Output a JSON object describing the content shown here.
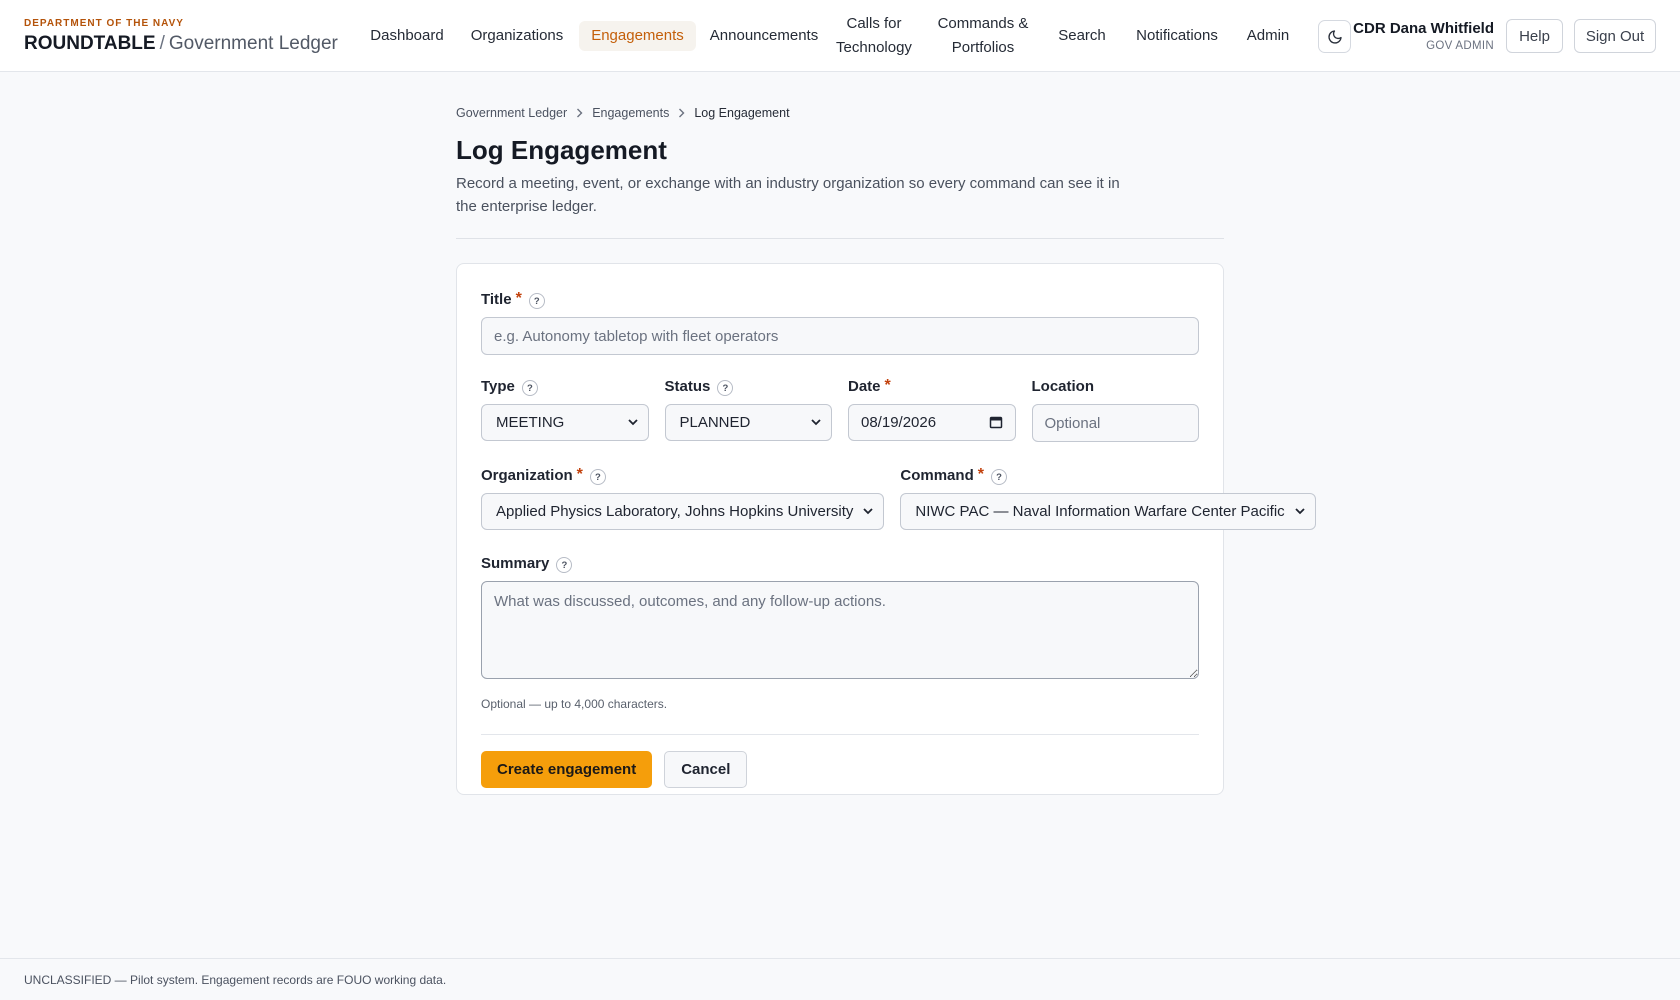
{
  "brand": {
    "department": "DEPARTMENT OF THE NAVY",
    "name": "ROUNDTABLE",
    "separator": "/",
    "subtitle": "Government Ledger"
  },
  "nav": {
    "items": [
      {
        "label": "Dashboard"
      },
      {
        "label": "Organizations"
      },
      {
        "label": "Engagements",
        "active": true
      },
      {
        "label": "Announcements"
      },
      {
        "label": "Calls for Technology"
      },
      {
        "label": "Commands & Portfolios"
      },
      {
        "label": "Search"
      },
      {
        "label": "Notifications"
      },
      {
        "label": "Admin"
      }
    ],
    "theme_icon": "moon-icon"
  },
  "user": {
    "name": "CDR Dana Whitfield",
    "role": "GOV ADMIN",
    "help_label": "Help",
    "signout_label": "Sign Out"
  },
  "breadcrumb": [
    "Government Ledger",
    "Engagements",
    "Log Engagement"
  ],
  "page": {
    "title": "Log Engagement",
    "description": "Record a meeting, event, or exchange with an industry organization so every command can see it in the enterprise ledger."
  },
  "form": {
    "title": {
      "label": "Title",
      "required": true,
      "value": "",
      "placeholder": "e.g. Autonomy tabletop with fleet operators"
    },
    "type": {
      "label": "Type",
      "value": "MEETING"
    },
    "status": {
      "label": "Status",
      "value": "PLANNED"
    },
    "date": {
      "label": "Date",
      "required": true,
      "value": "08/19/2026"
    },
    "location": {
      "label": "Location",
      "value": "",
      "placeholder": "Optional"
    },
    "organization": {
      "label": "Organization",
      "required": true,
      "value": "Applied Physics Laboratory, Johns Hopkins University"
    },
    "command": {
      "label": "Command",
      "required": true,
      "value": "NIWC PAC — Naval Information Warfare Center Pacific"
    },
    "summary": {
      "label": "Summary",
      "value": "",
      "placeholder": "What was discussed, outcomes, and any follow-up actions.",
      "hint": "Optional — up to 4,000 characters."
    },
    "help_glyph": "?",
    "required_marker": "*",
    "submit_label": "Create engagement",
    "cancel_label": "Cancel"
  },
  "footer": {
    "text": "UNCLASSIFIED — Pilot system. Engagement records are FOUO working data."
  },
  "colors": {
    "accent": "#f59e0b",
    "active_nav": "#c45f0a",
    "brand_dept": "#b4530a",
    "required": "#c2410c"
  }
}
